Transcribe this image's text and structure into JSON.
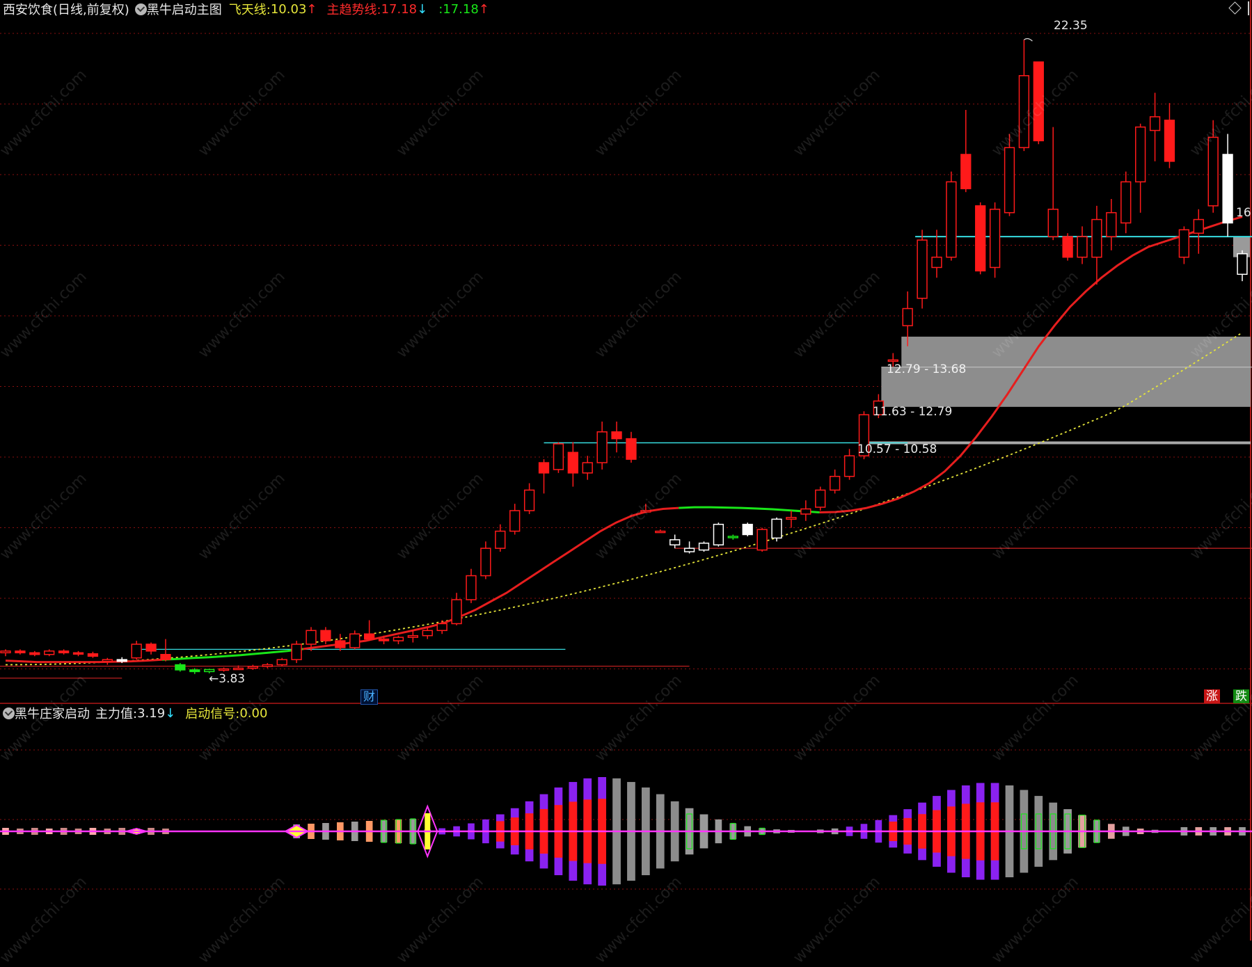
{
  "main_header": {
    "stock": "西安饮食(日线,前复权)",
    "indicator": "黑牛启动主图",
    "fly_label": "飞天线:",
    "fly_value": "10.03",
    "fly_arrow": "↑",
    "trend_label": "主趋势线:",
    "trend_value": "17.18",
    "trend_arrow": "↓",
    "extra_label": ":",
    "extra_value": "17.18",
    "extra_arrow": "↑"
  },
  "sub_header": {
    "indicator": "黑牛庄家启动",
    "main_label": "主力值:",
    "main_value": "3.19",
    "main_arrow": "↓",
    "signal_label": "启动信号:",
    "signal_value": "0.00"
  },
  "annotations": {
    "high_price": "22.35",
    "low_price": "3.83",
    "zone_1": "12.79 - 13.68",
    "zone_2": "11.63 - 12.79",
    "zone_3": "10.57 - 10.58",
    "right_edge": "16",
    "cai_tag": "财",
    "zhang_tag": "涨",
    "die_tag": "跌"
  },
  "watermark": "www.cfchi.com",
  "colors": {
    "up": "#ff1a1a",
    "down_green": "#19e619",
    "trend": "#e61e1e",
    "fly": "#e6e63a",
    "cyan": "#37dde0",
    "magenta": "#ff33ff",
    "purple": "#8a22f0",
    "grey": "#8c8c8c",
    "orange": "#ff8040",
    "grid": "#8a1010"
  },
  "chart_data": {
    "type": "candlestick",
    "title": "西安饮食(日线,前复权)",
    "price_high": 22.35,
    "price_low": 3.83,
    "candles": [
      {
        "o": 4.45,
        "h": 4.55,
        "l": 4.35,
        "c": 4.5
      },
      {
        "o": 4.5,
        "h": 4.55,
        "l": 4.4,
        "c": 4.45
      },
      {
        "o": 4.45,
        "h": 4.5,
        "l": 4.35,
        "c": 4.4
      },
      {
        "o": 4.4,
        "h": 4.55,
        "l": 4.35,
        "c": 4.5
      },
      {
        "o": 4.5,
        "h": 4.55,
        "l": 4.4,
        "c": 4.45
      },
      {
        "o": 4.45,
        "h": 4.5,
        "l": 4.35,
        "c": 4.42
      },
      {
        "o": 4.42,
        "h": 4.48,
        "l": 4.3,
        "c": 4.35
      },
      {
        "o": 4.2,
        "h": 4.3,
        "l": 4.1,
        "c": 4.25
      },
      {
        "o": 4.25,
        "h": 4.32,
        "l": 4.15,
        "c": 4.2
      },
      {
        "o": 4.3,
        "h": 4.8,
        "l": 4.25,
        "c": 4.7
      },
      {
        "o": 4.7,
        "h": 4.75,
        "l": 4.4,
        "c": 4.5
      },
      {
        "o": 4.4,
        "h": 4.85,
        "l": 4.2,
        "c": 4.25
      },
      {
        "o": 4.1,
        "h": 4.15,
        "l": 3.9,
        "c": 3.95
      },
      {
        "o": 3.95,
        "h": 4.0,
        "l": 3.83,
        "c": 3.9
      },
      {
        "o": 3.9,
        "h": 3.98,
        "l": 3.85,
        "c": 3.96
      },
      {
        "o": 3.96,
        "h": 4.02,
        "l": 3.9,
        "c": 3.98
      },
      {
        "o": 3.98,
        "h": 4.08,
        "l": 3.95,
        "c": 4.0
      },
      {
        "o": 4.0,
        "h": 4.1,
        "l": 3.95,
        "c": 4.05
      },
      {
        "o": 4.05,
        "h": 4.15,
        "l": 4.0,
        "c": 4.1
      },
      {
        "o": 4.1,
        "h": 4.3,
        "l": 4.05,
        "c": 4.25
      },
      {
        "o": 4.25,
        "h": 4.8,
        "l": 4.15,
        "c": 4.7
      },
      {
        "o": 4.7,
        "h": 5.2,
        "l": 4.5,
        "c": 5.1
      },
      {
        "o": 5.1,
        "h": 5.2,
        "l": 4.7,
        "c": 4.8
      },
      {
        "o": 4.8,
        "h": 5.0,
        "l": 4.5,
        "c": 4.6
      },
      {
        "o": 4.6,
        "h": 5.1,
        "l": 4.55,
        "c": 5.0
      },
      {
        "o": 5.0,
        "h": 5.4,
        "l": 4.8,
        "c": 4.85
      },
      {
        "o": 4.85,
        "h": 4.95,
        "l": 4.7,
        "c": 4.8
      },
      {
        "o": 4.8,
        "h": 4.95,
        "l": 4.7,
        "c": 4.9
      },
      {
        "o": 4.9,
        "h": 5.1,
        "l": 4.75,
        "c": 4.95
      },
      {
        "o": 4.95,
        "h": 5.2,
        "l": 4.85,
        "c": 5.1
      },
      {
        "o": 5.1,
        "h": 5.4,
        "l": 5.0,
        "c": 5.3
      },
      {
        "o": 5.3,
        "h": 6.2,
        "l": 5.25,
        "c": 6.0
      },
      {
        "o": 6.0,
        "h": 6.9,
        "l": 5.9,
        "c": 6.7
      },
      {
        "o": 6.7,
        "h": 7.7,
        "l": 6.6,
        "c": 7.5
      },
      {
        "o": 7.5,
        "h": 8.2,
        "l": 7.4,
        "c": 8.0
      },
      {
        "o": 8.0,
        "h": 8.8,
        "l": 7.9,
        "c": 8.6
      },
      {
        "o": 8.6,
        "h": 9.4,
        "l": 8.5,
        "c": 9.2
      },
      {
        "o": 10.0,
        "h": 10.1,
        "l": 9.1,
        "c": 9.7
      },
      {
        "o": 9.8,
        "h": 10.6,
        "l": 9.7,
        "c": 10.55
      },
      {
        "o": 10.3,
        "h": 10.6,
        "l": 9.3,
        "c": 9.7
      },
      {
        "o": 9.7,
        "h": 10.2,
        "l": 9.5,
        "c": 10.0
      },
      {
        "o": 10.0,
        "h": 11.2,
        "l": 9.8,
        "c": 10.9
      },
      {
        "o": 10.9,
        "h": 11.2,
        "l": 10.3,
        "c": 10.7
      },
      {
        "o": 10.7,
        "h": 10.9,
        "l": 10.0,
        "c": 10.1
      },
      {
        "o": 8.6,
        "h": 8.8,
        "l": 8.6,
        "c": 8.6
      },
      {
        "o": 8.0,
        "h": 8.05,
        "l": 8.0,
        "c": 8.0
      },
      {
        "o": 7.6,
        "h": 7.9,
        "l": 7.5,
        "c": 7.75
      },
      {
        "o": 7.4,
        "h": 7.7,
        "l": 7.35,
        "c": 7.5
      },
      {
        "o": 7.45,
        "h": 7.7,
        "l": 7.4,
        "c": 7.65
      },
      {
        "o": 7.6,
        "h": 8.25,
        "l": 7.55,
        "c": 8.2
      },
      {
        "o": 7.85,
        "h": 7.9,
        "l": 7.75,
        "c": 7.85
      },
      {
        "o": 8.2,
        "h": 8.25,
        "l": 7.85,
        "c": 7.9
      },
      {
        "o": 7.45,
        "h": 8.1,
        "l": 7.4,
        "c": 8.05
      },
      {
        "o": 7.8,
        "h": 8.4,
        "l": 7.7,
        "c": 8.35
      },
      {
        "o": 8.35,
        "h": 8.6,
        "l": 8.1,
        "c": 8.4
      },
      {
        "o": 8.5,
        "h": 8.9,
        "l": 8.3,
        "c": 8.65
      },
      {
        "o": 8.7,
        "h": 9.3,
        "l": 8.6,
        "c": 9.2
      },
      {
        "o": 9.2,
        "h": 9.8,
        "l": 9.1,
        "c": 9.6
      },
      {
        "o": 9.6,
        "h": 10.4,
        "l": 9.5,
        "c": 10.2
      },
      {
        "o": 10.2,
        "h": 11.5,
        "l": 10.1,
        "c": 11.4
      },
      {
        "o": 11.4,
        "h": 12.0,
        "l": 11.3,
        "c": 11.8
      },
      {
        "o": 13.0,
        "h": 13.2,
        "l": 12.8,
        "c": 13.0
      },
      {
        "o": 14.0,
        "h": 15.0,
        "l": 13.4,
        "c": 14.5
      },
      {
        "o": 14.8,
        "h": 16.8,
        "l": 14.5,
        "c": 16.5
      },
      {
        "o": 15.7,
        "h": 16.8,
        "l": 15.4,
        "c": 16.0
      },
      {
        "o": 16.0,
        "h": 18.5,
        "l": 15.9,
        "c": 18.2
      },
      {
        "o": 19.0,
        "h": 20.3,
        "l": 17.9,
        "c": 18.0
      },
      {
        "o": 17.5,
        "h": 17.6,
        "l": 15.5,
        "c": 15.6
      },
      {
        "o": 15.7,
        "h": 17.6,
        "l": 15.4,
        "c": 17.4
      },
      {
        "o": 17.3,
        "h": 19.6,
        "l": 17.2,
        "c": 19.2
      },
      {
        "o": 19.2,
        "h": 22.35,
        "l": 19.1,
        "c": 21.3
      },
      {
        "o": 21.7,
        "h": 21.7,
        "l": 19.3,
        "c": 19.4
      },
      {
        "o": 16.6,
        "h": 19.8,
        "l": 16.5,
        "c": 17.4
      },
      {
        "o": 16.6,
        "h": 16.7,
        "l": 15.9,
        "c": 16.0
      },
      {
        "o": 16.0,
        "h": 16.9,
        "l": 15.8,
        "c": 16.6
      },
      {
        "o": 16.0,
        "h": 17.5,
        "l": 15.2,
        "c": 17.1
      },
      {
        "o": 16.6,
        "h": 17.7,
        "l": 16.2,
        "c": 17.3
      },
      {
        "o": 17.0,
        "h": 18.5,
        "l": 16.7,
        "c": 18.2
      },
      {
        "o": 18.2,
        "h": 19.9,
        "l": 17.3,
        "c": 19.8
      },
      {
        "o": 19.7,
        "h": 20.8,
        "l": 18.8,
        "c": 20.1
      },
      {
        "o": 20.0,
        "h": 20.5,
        "l": 18.6,
        "c": 18.8
      },
      {
        "o": 16.0,
        "h": 16.9,
        "l": 15.8,
        "c": 16.8
      },
      {
        "o": 16.7,
        "h": 17.4,
        "l": 16.1,
        "c": 17.1
      },
      {
        "o": 17.5,
        "h": 20.0,
        "l": 17.3,
        "c": 19.5
      },
      {
        "o": 19.0,
        "h": 19.6,
        "l": 16.6,
        "c": 17.0
      },
      {
        "o": 15.5,
        "h": 16.2,
        "l": 15.3,
        "c": 16.1
      }
    ],
    "trend_line": [
      4.22,
      4.2,
      4.18,
      4.18,
      4.18,
      4.18,
      4.18,
      4.19,
      4.2,
      4.22,
      4.25,
      4.27,
      4.3,
      4.32,
      4.35,
      4.38,
      4.42,
      4.46,
      4.5,
      4.56,
      4.62,
      4.68,
      4.74,
      4.8,
      4.9,
      5.0,
      5.1,
      5.2,
      5.32,
      5.5,
      5.7,
      5.95,
      6.2,
      6.5,
      6.8,
      7.1,
      7.4,
      7.7,
      8.0,
      8.25,
      8.45,
      8.58,
      8.65,
      8.68,
      8.7,
      8.7,
      8.69,
      8.68,
      8.66,
      8.64,
      8.61,
      8.58,
      8.55,
      8.56,
      8.6,
      8.68,
      8.8,
      8.95,
      9.15,
      9.4,
      9.75,
      10.2,
      10.75,
      11.35,
      12.0,
      12.7,
      13.4,
      14.0,
      14.55,
      15.0,
      15.4,
      15.75,
      16.05,
      16.3,
      16.45,
      16.6,
      16.75,
      16.9,
      17.05,
      17.18
    ]
  }
}
